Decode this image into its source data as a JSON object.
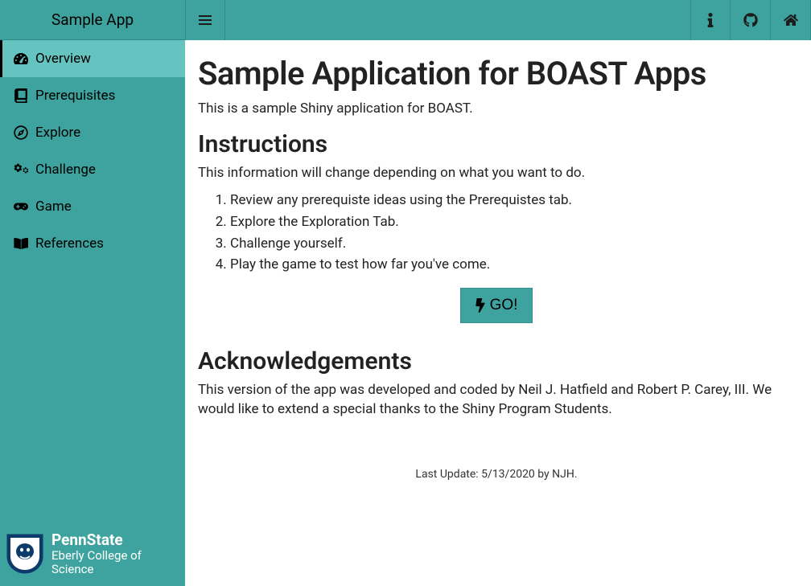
{
  "app": {
    "title": "Sample App"
  },
  "sidebar": {
    "items": [
      {
        "label": "Overview",
        "icon": "dashboard-icon",
        "active": true
      },
      {
        "label": " Prerequisites",
        "icon": "book-icon",
        "active": false
      },
      {
        "label": "Explore",
        "icon": "compass-icon",
        "active": false
      },
      {
        "label": "Challenge",
        "icon": "gears-icon",
        "active": false
      },
      {
        "label": "Game",
        "icon": "gamepad-icon",
        "active": false
      },
      {
        "label": "References",
        "icon": "book-open-icon",
        "active": false
      }
    ]
  },
  "footer": {
    "line1": "PennState",
    "line2": "Eberly College of Science"
  },
  "topbar": {
    "left": [
      "menu-toggle"
    ],
    "right": [
      "info-icon",
      "github-icon",
      "home-icon"
    ]
  },
  "main": {
    "title": "Sample Application for BOAST Apps",
    "intro": "This is a sample Shiny application for BOAST.",
    "instructions_heading": "Instructions",
    "instructions_intro": "This information will change depending on what you want to do.",
    "instructions_list": [
      "Review any prerequiste ideas using the Prerequistes tab.",
      "Explore the Exploration Tab.",
      "Challenge yourself.",
      "Play the game to test how far you've come."
    ],
    "go_label": " GO!",
    "ack_heading": "Acknowledgements",
    "ack_body": "This version of the app was developed and coded by Neil J. Hatfield and Robert P. Carey, III. We would like to extend a special thanks to the Shiny Program Students.",
    "last_update": "Last Update: 5/13/2020 by NJH."
  },
  "colors": {
    "primary": "#3ea39e",
    "primary_light": "#65c4bf"
  }
}
